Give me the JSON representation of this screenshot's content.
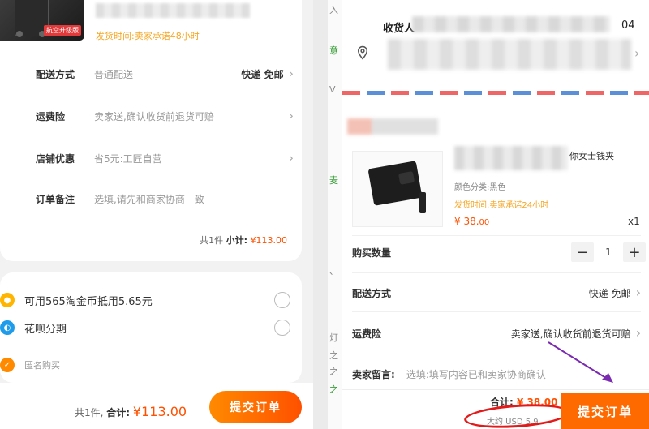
{
  "left": {
    "thumb_badge": "航空升级版",
    "ship_time": "发货时间:卖家承诺48小时",
    "rows": [
      {
        "label": "配送方式",
        "value": "普通配送",
        "right": "快递 免邮"
      },
      {
        "label": "运费险",
        "value": "卖家送,确认收货前退货可赔",
        "right": ""
      },
      {
        "label": "店铺优惠",
        "value": "省5元:工匠自营",
        "right": ""
      },
      {
        "label": "订单备注",
        "value": "选填,请先和商家协商一致",
        "right": ""
      }
    ],
    "subtotal_count": "共1件",
    "subtotal_label": "小计:",
    "subtotal_price": "¥113.00",
    "coin_text": "可用565淘金币抵用5.65元",
    "huabei_text": "花呗分期",
    "anon_text": "匿名购买",
    "total_count": "共1件,",
    "total_label": "合计:",
    "total_price": "¥113.00",
    "submit_label": "提交订单"
  },
  "right": {
    "strip_chars": [
      "入",
      "意",
      "V",
      "麦",
      "、",
      "灯",
      "之",
      "之",
      "之"
    ],
    "receiver_label": "收货人",
    "receiver_tail": "04",
    "product_name": "你女士钱夹",
    "product_attr": "颜色分类:黑色",
    "ship_time": "发货时间:卖家承诺24小时",
    "price_int": "¥ 38.",
    "price_dec": "00",
    "quantity_x": "x1",
    "qty_label": "购买数量",
    "qty_minus": "−",
    "qty_value": "1",
    "qty_plus": "+",
    "delivery_label": "配送方式",
    "delivery_value": "快递 免邮",
    "insurance_label": "运费险",
    "insurance_value": "卖家送,确认收货前退货可赔",
    "remark_label": "卖家留言:",
    "remark_placeholder": "选填:填写内容已和卖家协商确认",
    "total_label": "合计:",
    "total_amount": "¥ 38.00",
    "usd_text": "大约 USD 5.9",
    "submit_label": "提交订单",
    "accent_color": "#ff6a00"
  }
}
